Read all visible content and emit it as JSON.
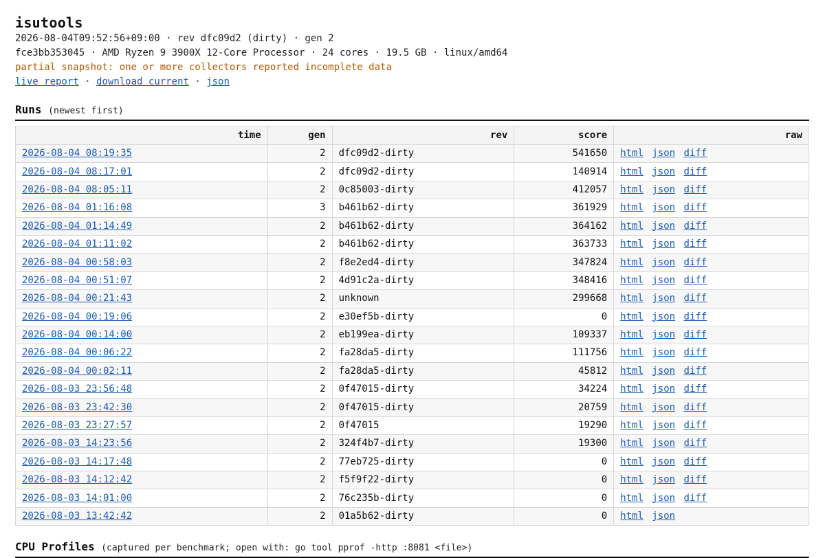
{
  "app": {
    "title": "isutools",
    "meta_line1": "2026-08-04T09:52:56+09:00 · rev dfc09d2 (dirty) · gen 2",
    "meta_line2": "fce3bb353045 · AMD Ryzen 9 3900X 12-Core Processor · 24 cores · 19.5 GB · linux/amd64",
    "warning": "partial snapshot: one or more collectors reported incomplete data"
  },
  "links": {
    "live_report": "live report",
    "download_current": "download current",
    "json": "json",
    "separator": "·"
  },
  "runs": {
    "title": "Runs",
    "hint": "(newest first)",
    "columns": [
      "time",
      "gen",
      "rev",
      "score",
      "raw"
    ],
    "link_labels": {
      "html": "html",
      "json": "json",
      "diff": "diff"
    },
    "rows": [
      {
        "time": "2026-08-04 08:19:35",
        "gen": "2",
        "rev": "dfc09d2-dirty",
        "score": "541650",
        "diff": true
      },
      {
        "time": "2026-08-04 08:17:01",
        "gen": "2",
        "rev": "dfc09d2-dirty",
        "score": "140914",
        "diff": true
      },
      {
        "time": "2026-08-04 08:05:11",
        "gen": "2",
        "rev": "0c85003-dirty",
        "score": "412057",
        "diff": true
      },
      {
        "time": "2026-08-04 01:16:08",
        "gen": "3",
        "rev": "b461b62-dirty",
        "score": "361929",
        "diff": true
      },
      {
        "time": "2026-08-04 01:14:49",
        "gen": "2",
        "rev": "b461b62-dirty",
        "score": "364162",
        "diff": true
      },
      {
        "time": "2026-08-04 01:11:02",
        "gen": "2",
        "rev": "b461b62-dirty",
        "score": "363733",
        "diff": true
      },
      {
        "time": "2026-08-04 00:58:03",
        "gen": "2",
        "rev": "f8e2ed4-dirty",
        "score": "347824",
        "diff": true
      },
      {
        "time": "2026-08-04 00:51:07",
        "gen": "2",
        "rev": "4d91c2a-dirty",
        "score": "348416",
        "diff": true
      },
      {
        "time": "2026-08-04 00:21:43",
        "gen": "2",
        "rev": "unknown",
        "score": "299668",
        "diff": true
      },
      {
        "time": "2026-08-04 00:19:06",
        "gen": "2",
        "rev": "e30ef5b-dirty",
        "score": "0",
        "diff": true
      },
      {
        "time": "2026-08-04 00:14:00",
        "gen": "2",
        "rev": "eb199ea-dirty",
        "score": "109337",
        "diff": true
      },
      {
        "time": "2026-08-04 00:06:22",
        "gen": "2",
        "rev": "fa28da5-dirty",
        "score": "111756",
        "diff": true
      },
      {
        "time": "2026-08-04 00:02:11",
        "gen": "2",
        "rev": "fa28da5-dirty",
        "score": "45812",
        "diff": true
      },
      {
        "time": "2026-08-03 23:56:48",
        "gen": "2",
        "rev": "0f47015-dirty",
        "score": "34224",
        "diff": true
      },
      {
        "time": "2026-08-03 23:42:30",
        "gen": "2",
        "rev": "0f47015-dirty",
        "score": "20759",
        "diff": true
      },
      {
        "time": "2026-08-03 23:27:57",
        "gen": "2",
        "rev": "0f47015",
        "score": "19290",
        "diff": true
      },
      {
        "time": "2026-08-03 14:23:56",
        "gen": "2",
        "rev": "324f4b7-dirty",
        "score": "19300",
        "diff": true
      },
      {
        "time": "2026-08-03 14:17:48",
        "gen": "2",
        "rev": "77eb725-dirty",
        "score": "0",
        "diff": true
      },
      {
        "time": "2026-08-03 14:12:42",
        "gen": "2",
        "rev": "f5f9f22-dirty",
        "score": "0",
        "diff": true
      },
      {
        "time": "2026-08-03 14:01:00",
        "gen": "2",
        "rev": "76c235b-dirty",
        "score": "0",
        "diff": true
      },
      {
        "time": "2026-08-03 13:42:42",
        "gen": "2",
        "rev": "01a5b62-dirty",
        "score": "0",
        "diff": false
      }
    ]
  },
  "cpu_profiles": {
    "title": "CPU Profiles",
    "hint": "(captured per benchmark; open with: go tool pprof -http :8081 <file>)"
  }
}
